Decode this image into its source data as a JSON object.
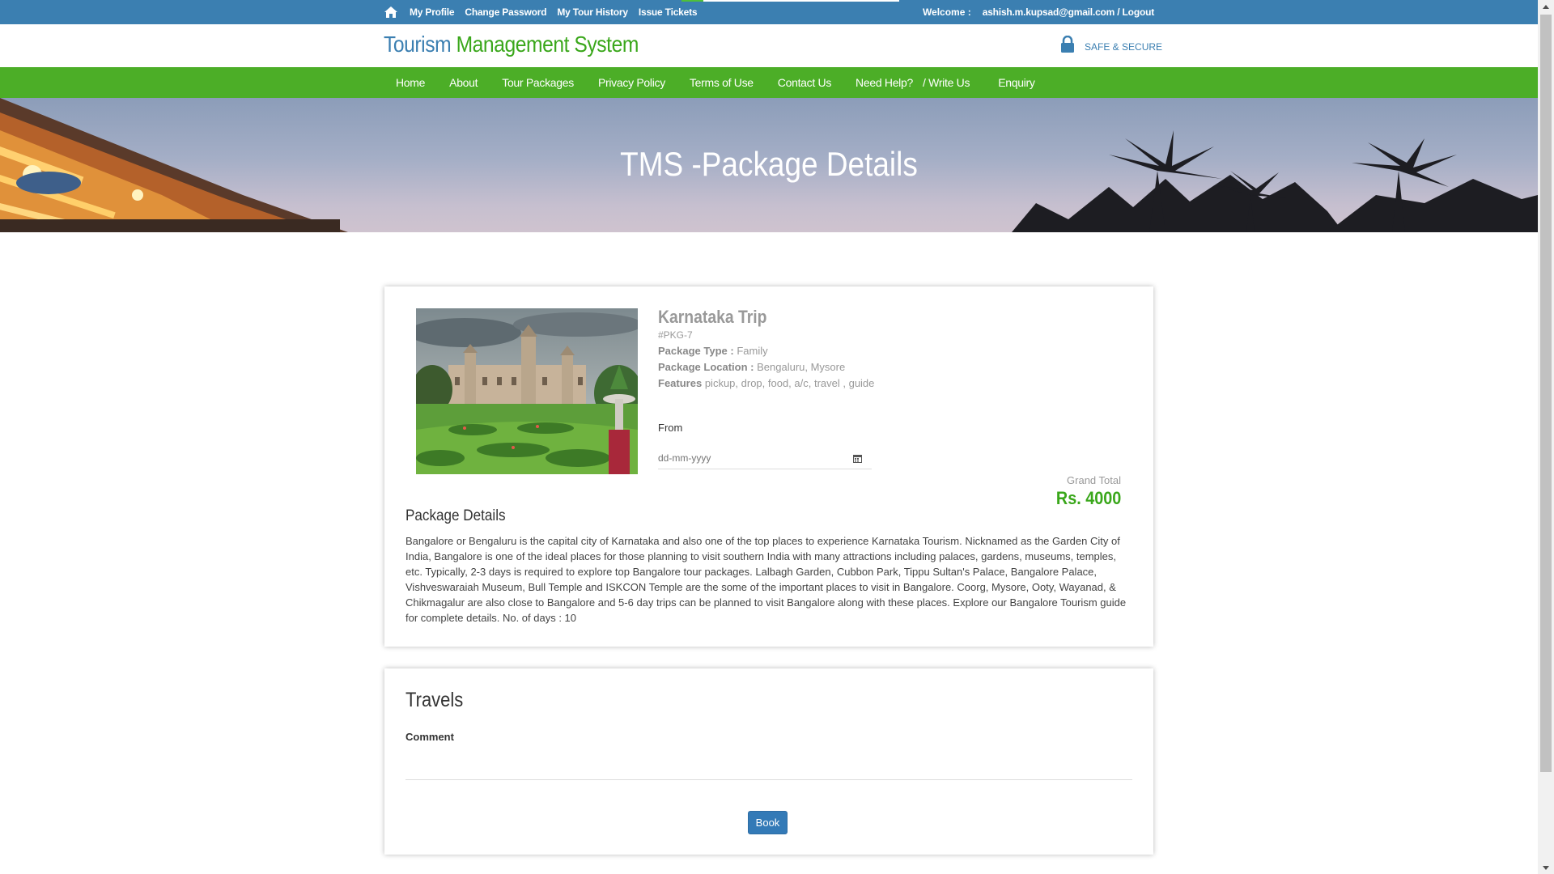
{
  "topbar": {
    "links": [
      "My Profile",
      "Change Password",
      "My Tour History",
      "Issue Tickets"
    ],
    "welcome": "Welcome :",
    "user_logout": "ashish.m.kupsad@gmail.com / Logout"
  },
  "header": {
    "logo_part1": "Tourism",
    "logo_part2": "Management System",
    "secure_label": "SAFE & SECURE"
  },
  "nav": {
    "items": [
      "Home",
      "About",
      "Tour Packages",
      "Privacy Policy",
      "Terms of Use",
      "Contact Us",
      "Need Help?",
      "/ Write Us",
      "Enquiry"
    ]
  },
  "banner": {
    "title": "TMS -Package Details"
  },
  "package": {
    "name": "Karnataka Trip",
    "code": "#PKG-7",
    "type_label": "Package Type :",
    "type_value": "Family",
    "location_label": "Package Location :",
    "location_value": "Bengaluru, Mysore",
    "features_label": "Features",
    "features_value": "pickup, drop, food, a/c, travel , guide",
    "from_label": "From",
    "date_placeholder": "dd-mm-yyyy",
    "grand_total_label": "Grand Total",
    "grand_total_value": "Rs. 4000",
    "details_title": "Package Details",
    "details_text": "Bangalore or Bengaluru is the capital city of Karnataka and also one of the top places to experience Karnataka Tourism. Nicknamed as the Garden City of India, Bangalore is one of the ideal places for those planning to visit southern India with many attractions including palaces, gardens, museums, temples, etc. Typically, 2-3 days is required to explore top Bangalore tour packages. Lalbagh Garden, Cubbon Park, Tippu Sultan's Palace, Bangalore Palace, Vishveswaraiah Museum, Bull Temple and ISKCON Temple are the some of the important places to visit in Bangalore. Coorg, Mysore, Ooty, Wayanad, & Chikmagalur are also close to Bangalore and 5-6 day trips can be planned to visit Bangalore along with these places. Explore our Bangalore Tourism guide for complete details. No. of days : 10"
  },
  "booking": {
    "title": "Travels",
    "comment_label": "Comment",
    "book_label": "Book"
  },
  "colors": {
    "topbar": "#3b7fb1",
    "nav": "#4cae27",
    "accent_green": "#3aa71b",
    "button": "#337ab7"
  }
}
